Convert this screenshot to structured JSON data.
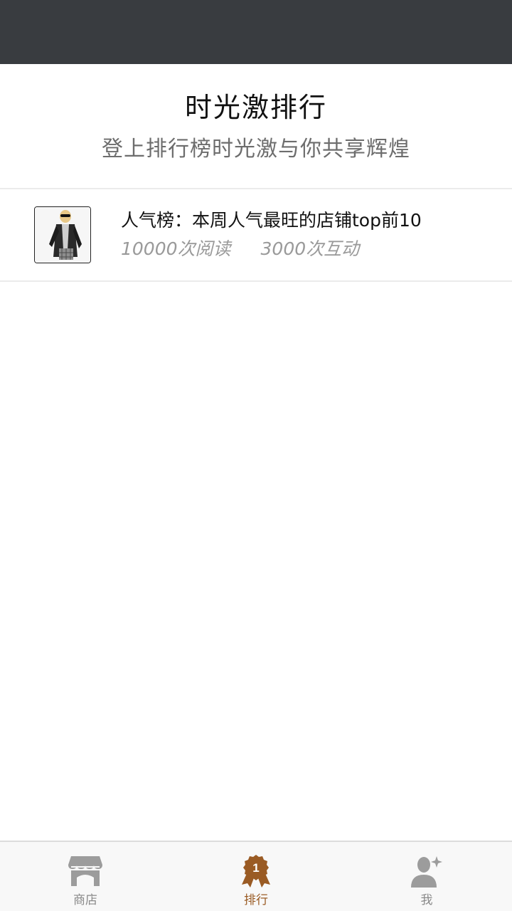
{
  "header": {
    "title": "时光激排行",
    "subtitle": "登上排行榜时光激与你共享辉煌"
  },
  "ranking_list": [
    {
      "title": "人气榜：本周人气最旺的店铺top前10",
      "reads": "10000次阅读",
      "interactions": "3000次互动",
      "thumbnail_icon": "fashion-model-photo"
    }
  ],
  "tabbar": {
    "tabs": [
      {
        "label": "商店",
        "icon": "store-icon",
        "active": false
      },
      {
        "label": "排行",
        "icon": "ranking-medal-icon",
        "active": true,
        "badge": "1"
      },
      {
        "label": "我",
        "icon": "user-icon",
        "active": false
      }
    ]
  },
  "colors": {
    "status_bar": "#393c40",
    "accent": "#9a5b24",
    "inactive_icon": "#9c9c9c"
  }
}
